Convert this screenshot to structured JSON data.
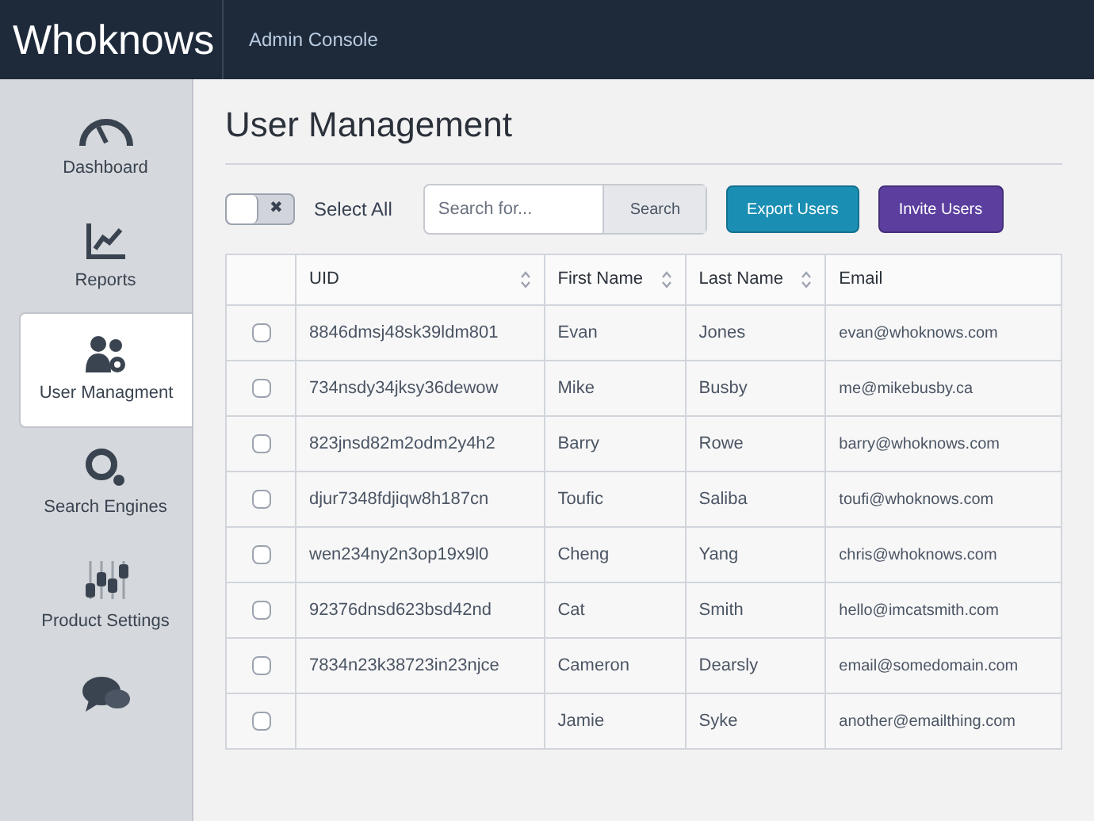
{
  "header": {
    "logo": "Whoknows",
    "title": "Admin Console"
  },
  "sidebar": {
    "items": [
      {
        "label": "Dashboard",
        "kind": "gauge",
        "selected": false
      },
      {
        "label": "Reports",
        "kind": "chart",
        "selected": false
      },
      {
        "label": "User Managment",
        "kind": "users",
        "selected": true
      },
      {
        "label": "Search Engines",
        "kind": "search",
        "selected": false
      },
      {
        "label": "Product Settings",
        "kind": "sliders",
        "selected": false
      },
      {
        "kind": "chat",
        "selected": false
      }
    ]
  },
  "page": {
    "title": "User Management"
  },
  "toolbar": {
    "select_all": {
      "label": "Select All",
      "on": false,
      "off_glyph": "✖"
    },
    "search": {
      "placeholder": "Search for...",
      "button": "Search"
    },
    "buttons": [
      {
        "label": "Export Users",
        "kind": "teal"
      },
      {
        "label": "Invite Users",
        "kind": "purple"
      }
    ]
  },
  "table": {
    "columns": [
      {
        "label": "UID",
        "sortable": true
      },
      {
        "label": "First Name",
        "sortable": true
      },
      {
        "label": "Last Name",
        "sortable": true
      },
      {
        "label": "Email",
        "sortable": false
      }
    ],
    "rows": [
      {
        "checked": false,
        "cells": [
          "8846dmsj48sk39ldm801",
          "Evan",
          "Jones",
          "evan@whoknows.com"
        ]
      },
      {
        "checked": false,
        "cells": [
          "734nsdy34jksy36dewow",
          "Mike",
          "Busby",
          "me@mikebusby.ca"
        ]
      },
      {
        "checked": false,
        "cells": [
          "823jnsd82m2odm2y4h2",
          "Barry",
          "Rowe",
          "barry@whoknows.com"
        ]
      },
      {
        "checked": false,
        "cells": [
          "djur7348fdjiqw8h187cn",
          "Toufic",
          "Saliba",
          "toufi@whoknows.com"
        ]
      },
      {
        "checked": false,
        "cells": [
          "wen234ny2n3op19x9l0",
          "Cheng",
          "Yang",
          "chris@whoknows.com"
        ]
      },
      {
        "checked": false,
        "cells": [
          "92376dnsd623bsd42nd",
          "Cat",
          "Smith",
          "hello@imcatsmith.com"
        ]
      },
      {
        "checked": false,
        "cells": [
          "7834n23k38723in23njce",
          "Cameron",
          "Dearsly",
          "email@somedomain.com"
        ]
      },
      {
        "checked": false,
        "cells": [
          "",
          "Jamie",
          "Syke",
          "another@emailthing.com"
        ]
      }
    ]
  }
}
